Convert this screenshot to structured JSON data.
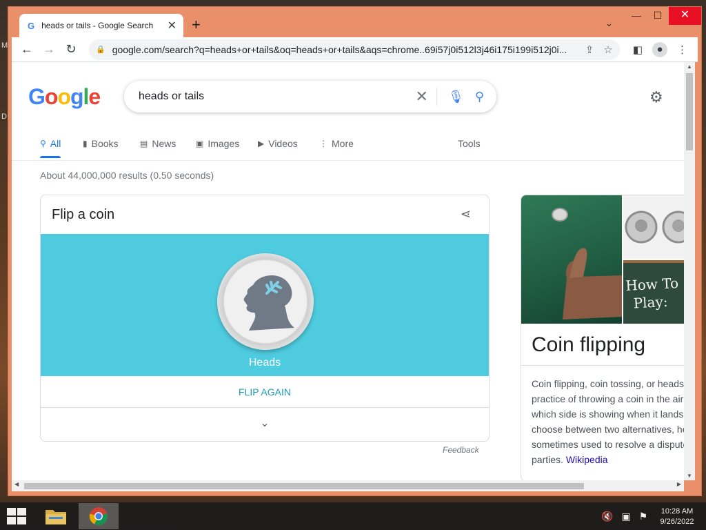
{
  "browser": {
    "tab_title": "heads or tails - Google Search",
    "url": "google.com/search?q=heads+or+tails&oq=heads+or+tails&aqs=chrome..69i57j0i512l3j46i175i199i512j0i..."
  },
  "search": {
    "query": "heads or tails",
    "tabs": [
      {
        "label": "All",
        "icon": "search-icon"
      },
      {
        "label": "Books",
        "icon": "book-icon"
      },
      {
        "label": "News",
        "icon": "news-icon"
      },
      {
        "label": "Images",
        "icon": "image-icon"
      },
      {
        "label": "Videos",
        "icon": "video-icon"
      },
      {
        "label": "More",
        "icon": "more-vertical-icon"
      }
    ],
    "tools_label": "Tools",
    "result_stats": "About 44,000,000 results (0.50 seconds)"
  },
  "coin_card": {
    "title": "Flip a coin",
    "result": "Heads",
    "flip_again_label": "FLIP AGAIN",
    "feedback_label": "Feedback"
  },
  "knowledge_panel": {
    "title": "Coin flipping",
    "image_text": [
      "How To",
      "Play:"
    ],
    "description_lines": [
      "Coin flipping, coin tossing, or heads o",
      "practice of throwing a coin in the air a",
      "which side is showing when it lands, i",
      "choose between two alternatives, hea",
      "sometimes used to resolve a dispute",
      "parties."
    ],
    "source_link": "Wikipedia"
  },
  "taskbar": {
    "time": "10:28 AM",
    "date": "9/26/2022"
  },
  "colors": {
    "window_frame": "#e9906a",
    "coin_background": "#4ecbde",
    "link_blue": "#1a73e8",
    "flip_again": "#1a9bbf"
  }
}
